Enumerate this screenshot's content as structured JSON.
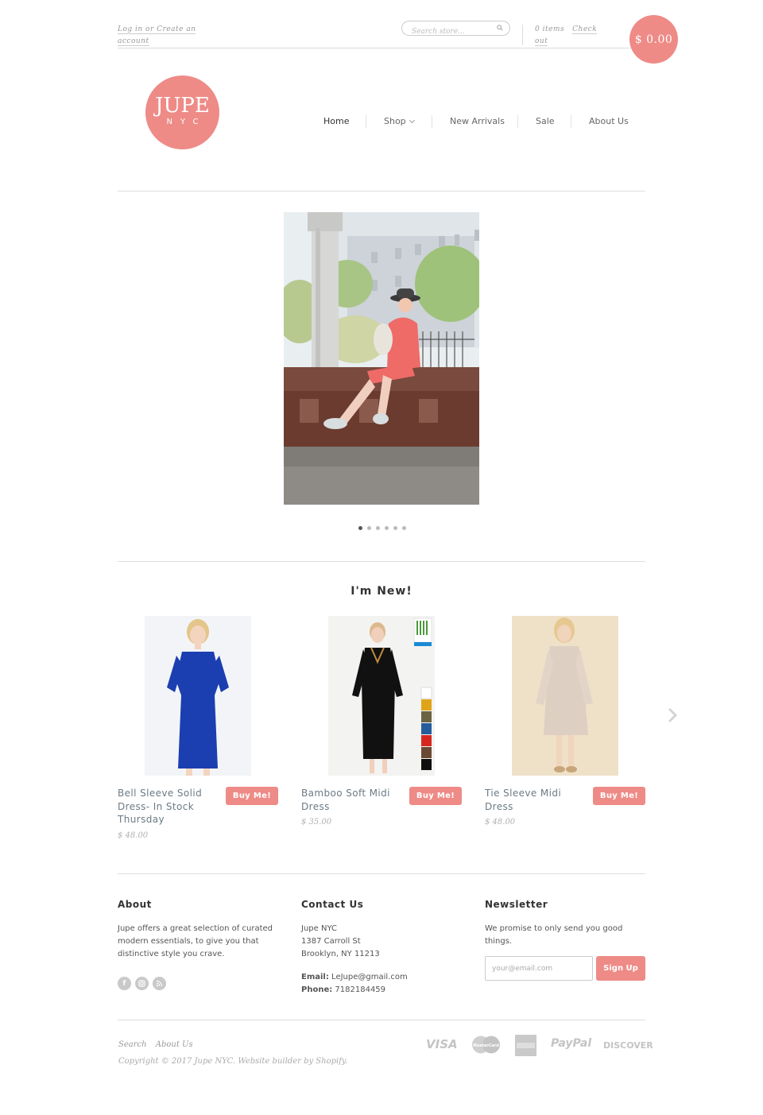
{
  "header": {
    "login_text": "Log in or Create an account",
    "search_placeholder": "Search store...",
    "cart_items_text": "0 items",
    "checkout_text": "Check out",
    "cart_total": "$ 0.00"
  },
  "logo": {
    "line1": "JUPE",
    "line2": "NYC"
  },
  "nav": {
    "items": [
      {
        "label": "Home"
      },
      {
        "label": "Shop"
      },
      {
        "label": "New Arrivals"
      },
      {
        "label": "Sale"
      },
      {
        "label": "About Us"
      }
    ]
  },
  "slideshow": {
    "dot_count": 6,
    "active_index": 0
  },
  "featured": {
    "title": "I'm New!",
    "products": [
      {
        "name": "Bell Sleeve Solid Dress- In Stock Thursday",
        "price": "$ 48.00",
        "buy_label": "Buy Me!",
        "dress_color": "#1b3fb0"
      },
      {
        "name": "Bamboo Soft Midi Dress",
        "price": "$ 35.00",
        "buy_label": "Buy Me!",
        "dress_color": "#111111"
      },
      {
        "name": "Tie Sleeve Midi Dress",
        "price": "$ 48.00",
        "buy_label": "Buy Me!",
        "dress_color": "#ddcfc2"
      }
    ]
  },
  "footer": {
    "about": {
      "title": "About",
      "text": "Jupe offers a great selection of curated modern essentials, to give you that distinctive style you crave."
    },
    "contact": {
      "title": "Contact Us",
      "line1": "Jupe NYC",
      "line2": "1387 Carroll St",
      "line3": "Brooklyn, NY 11213",
      "email_label": "Email:",
      "email": "LeJupe@gmail.com",
      "phone_label": "Phone:",
      "phone": "7182184459"
    },
    "newsletter": {
      "title": "Newsletter",
      "text": "We promise to only send you good things.",
      "placeholder": "your@email.com",
      "button": "Sign Up"
    },
    "links": [
      "Search",
      "About Us"
    ],
    "copyright": "Copyright © 2017 Jupe NYC. Website builder by Shopify.",
    "payments": [
      "VISA",
      "MasterCard",
      "American Express",
      "PayPal",
      "DISCOVER"
    ]
  },
  "colors": {
    "accent": "#ee8b87"
  }
}
